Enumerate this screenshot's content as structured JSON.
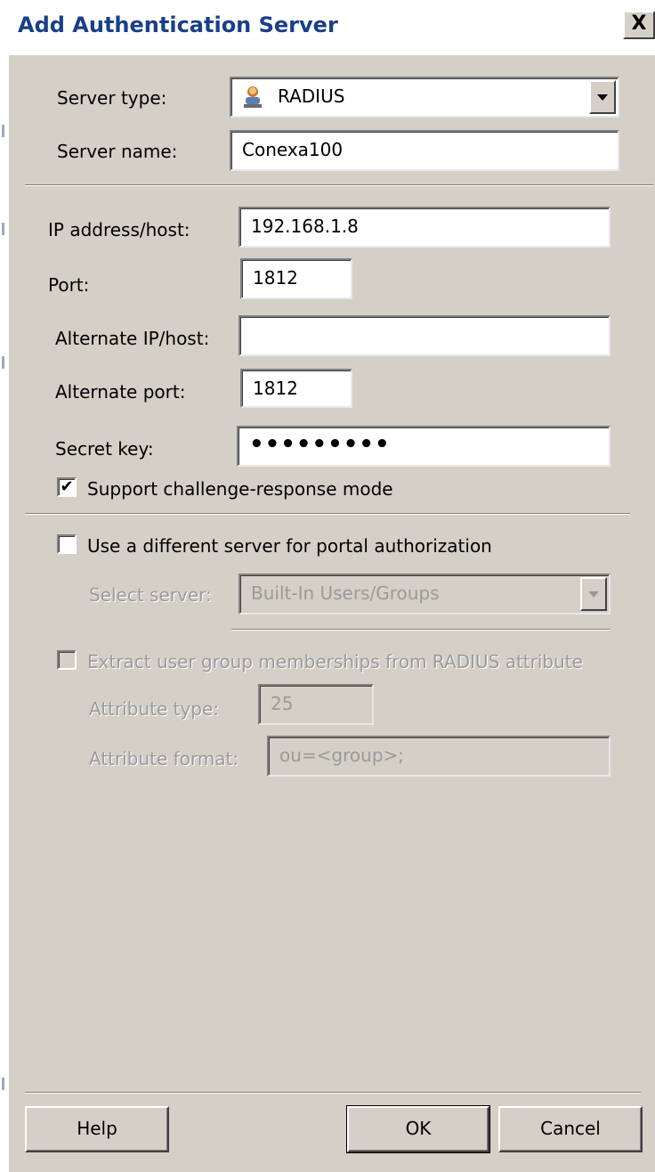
{
  "dialog": {
    "title": "Add Authentication Server",
    "close_label": "X"
  },
  "server": {
    "type_label": "Server type:",
    "type_value": "RADIUS",
    "type_icon": "radius-server-icon",
    "name_label": "Server name:",
    "name_value": "Conexa100"
  },
  "connection": {
    "ip_label": "IP address/host:",
    "ip_value": "192.168.1.8",
    "port_label": "Port:",
    "port_value": "1812",
    "alt_ip_label": "Alternate IP/host:",
    "alt_ip_value": "",
    "alt_port_label": "Alternate port:",
    "alt_port_value": "1812",
    "secret_label": "Secret key:",
    "secret_value": "•••••••••",
    "challenge_label": "Support challenge-response mode",
    "challenge_checked": true,
    "challenge_mark": "✔"
  },
  "portal": {
    "different_server_label": "Use a different server for portal authorization",
    "different_server_checked": false,
    "select_label": "Select server:",
    "select_value": "Built-In Users/Groups"
  },
  "groups": {
    "extract_label": "Extract user group memberships from RADIUS attribute",
    "extract_checked": false,
    "attr_type_label": "Attribute type:",
    "attr_type_value": "25",
    "attr_format_label": "Attribute format:",
    "attr_format_value": "ou=<group>;"
  },
  "buttons": {
    "help": "Help",
    "ok": "OK",
    "cancel": "Cancel"
  },
  "colors": {
    "dialog_bg": "#d4d0c8",
    "title_text": "#1a3f88",
    "disabled_text": "#9a9a9a"
  }
}
